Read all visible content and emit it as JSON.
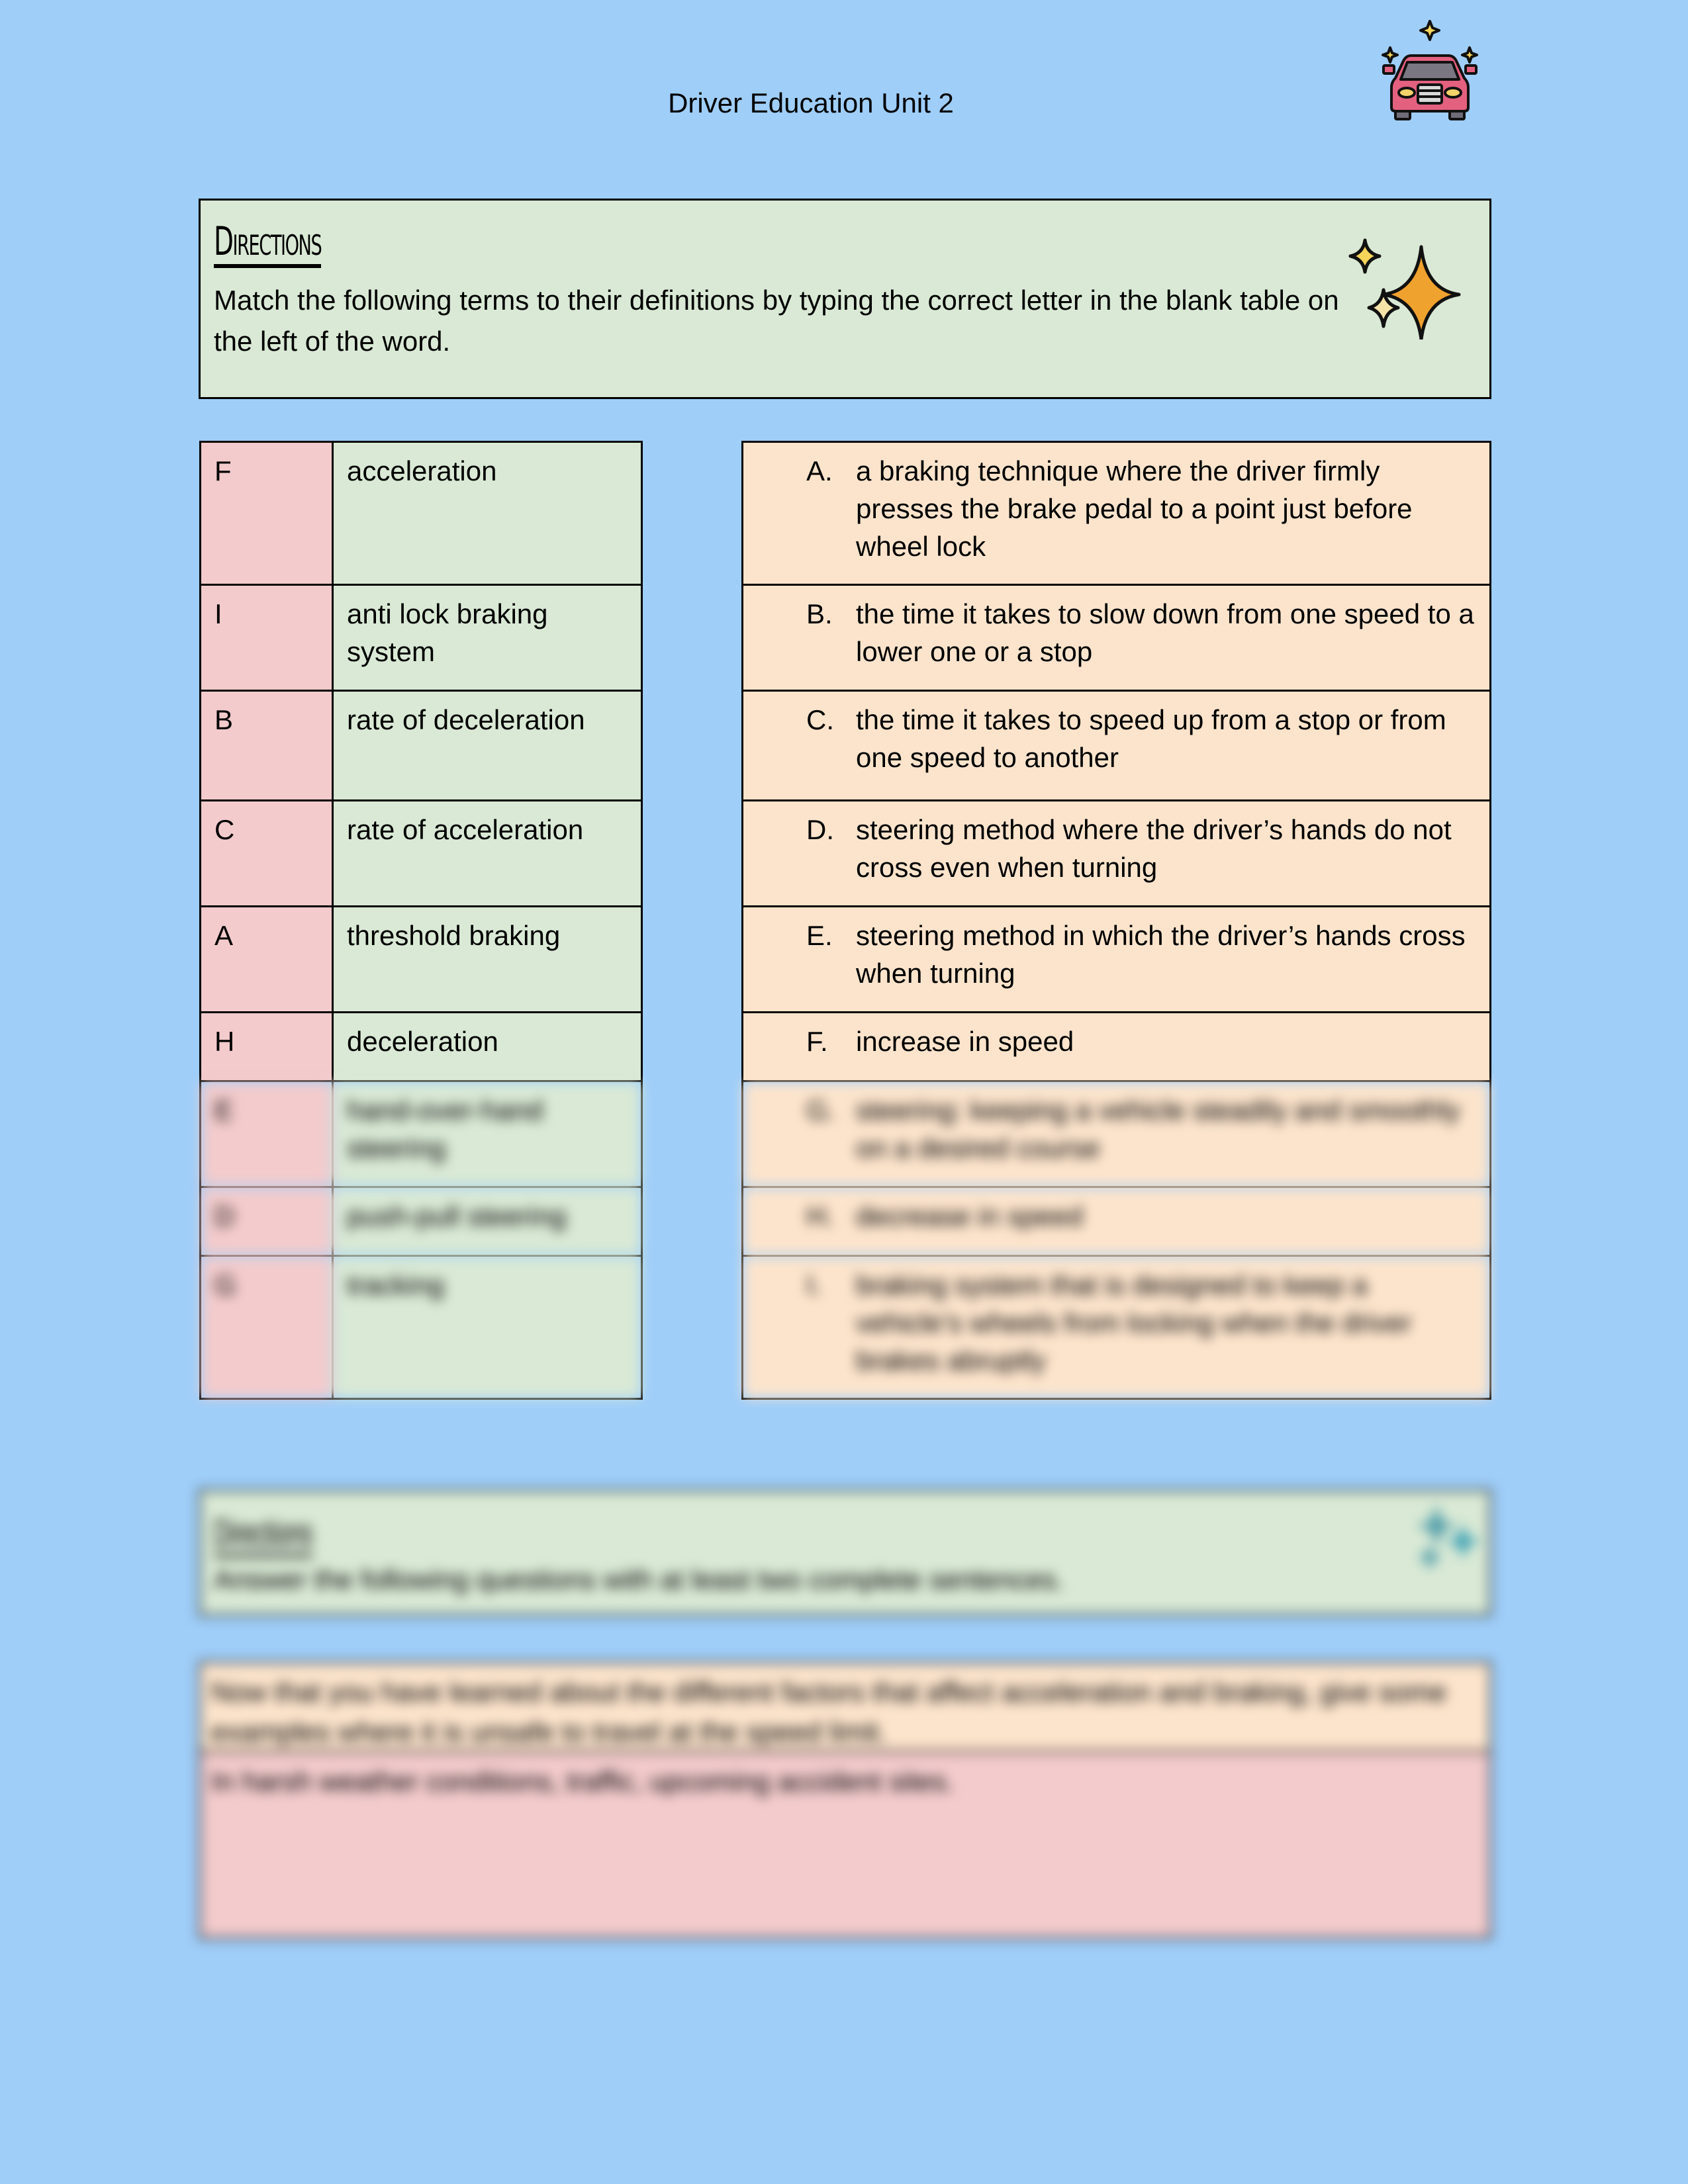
{
  "header": {
    "title": "Driver Education Unit 2",
    "icon": "car-sparkle-icon"
  },
  "directions": {
    "heading": "Directions",
    "text": "Match the following terms to their definitions by typing the correct letter in the blank table on the left of the word.",
    "icon": "sparkles-icon",
    "colors": {
      "box_bg": "#d9e9d5",
      "star_main": "#f0a22e",
      "star_small": "#f5d45a"
    }
  },
  "terms": [
    {
      "answer": "F",
      "term": "acceleration"
    },
    {
      "answer": "I",
      "term": "anti lock braking system"
    },
    {
      "answer": "B",
      "term": "rate of deceleration"
    },
    {
      "answer": "C",
      "term": "rate of acceleration"
    },
    {
      "answer": "A",
      "term": "threshold braking"
    },
    {
      "answer": "H",
      "term": "deceleration"
    },
    {
      "answer": "E",
      "term": "hand-over-hand steering"
    },
    {
      "answer": "D",
      "term": "push-pull steering"
    },
    {
      "answer": "G",
      "term": "tracking"
    }
  ],
  "definitions": [
    {
      "letter": "A.",
      "text": "a braking technique where the driver firmly presses the brake pedal to a point just before wheel lock"
    },
    {
      "letter": "B.",
      "text": "the time it takes to slow down from one speed to a lower one or a stop"
    },
    {
      "letter": "C.",
      "text": "the time it takes to speed up from a stop or from one speed to another"
    },
    {
      "letter": "D.",
      "text": "steering method where the driver’s hands do not cross even when turning"
    },
    {
      "letter": "E.",
      "text": " steering method in which the driver’s hands cross when turning"
    },
    {
      "letter": "F.",
      "text": "increase in speed"
    },
    {
      "letter": "G.",
      "text": "steering: keeping a vehicle steadily and smoothly on a desired course"
    },
    {
      "letter": "H.",
      "text": "decrease in speed"
    },
    {
      "letter": "I.",
      "text": "braking system that is designed to keep a vehicle’s wheels from locking when the driver brakes abruptly"
    }
  ],
  "directions2": {
    "heading": "Directions",
    "text": "Answer the following questions with at least two complete sentences."
  },
  "question": {
    "prompt": "Now that you have learned about the different factors that affect acceleration and braking, give some examples where it is unsafe to travel at the speed limit.",
    "answer": "In harsh weather conditions, traffic, upcoming accident sites."
  },
  "colors": {
    "page_bg": "#9fcef9",
    "answer_cell": "#f3cbcc",
    "term_cell": "#d9e9d5",
    "definition_cell": "#fce4cc"
  }
}
